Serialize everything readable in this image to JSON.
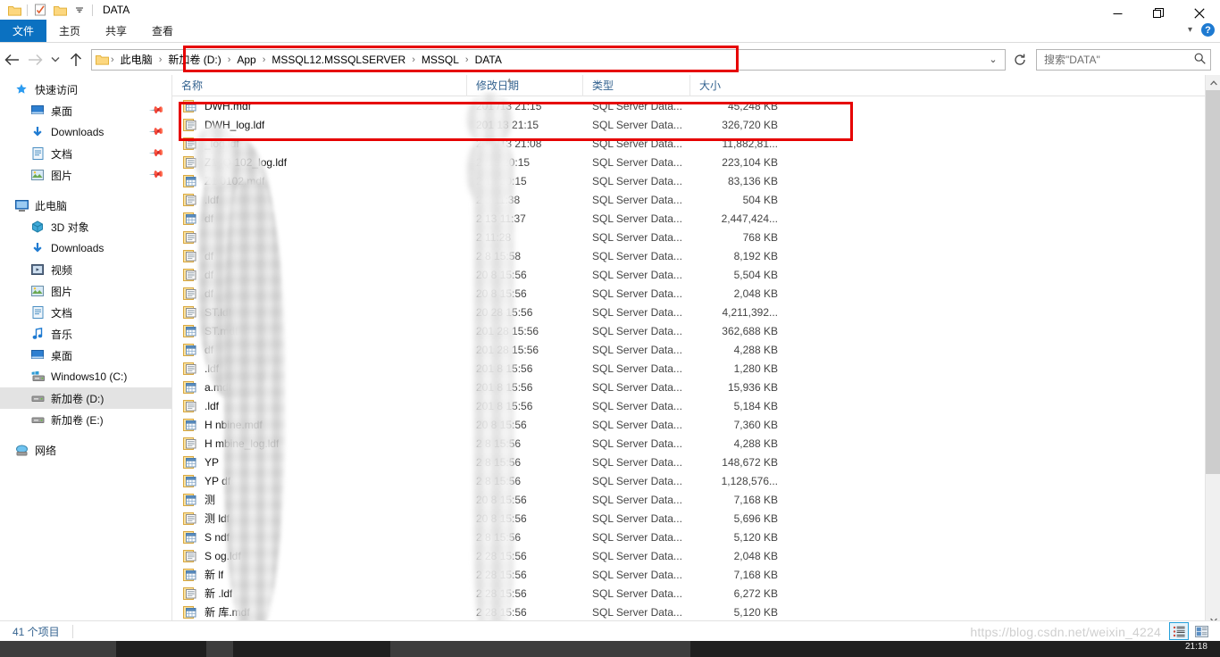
{
  "window": {
    "title": "DATA",
    "quick_access": [
      "folder-icon",
      "properties-checkbox-icon",
      "new-folder-icon",
      "customize-dropdown-icon"
    ],
    "controls": {
      "minimize": "—",
      "maximize": "❐",
      "close": "✕"
    }
  },
  "ribbon": {
    "tabs": [
      {
        "label": "文件",
        "active": true
      },
      {
        "label": "主页",
        "active": false
      },
      {
        "label": "共享",
        "active": false
      },
      {
        "label": "查看",
        "active": false
      }
    ],
    "collapse_icon": "chevron-down-icon",
    "help_label": "?"
  },
  "nav": {
    "back": "←",
    "forward": "→",
    "recent": "⌄",
    "up": "↑",
    "refresh": "↻",
    "history_dropdown": "⌄"
  },
  "address": {
    "folder_icon": "folder-icon",
    "separator": "›",
    "crumbs": [
      "此电脑",
      "新加卷 (D:)",
      "App",
      "MSSQL12.MSSQLSERVER",
      "MSSQL",
      "DATA"
    ]
  },
  "search": {
    "placeholder": "搜索\"DATA\"",
    "value": "",
    "icon": "search-icon"
  },
  "sidebar": {
    "groups": [
      {
        "name": "quick-access",
        "header": {
          "label": "快速访问",
          "icon": "star-pin-icon"
        },
        "items": [
          {
            "label": "桌面",
            "icon": "desktop-icon",
            "pinned": true
          },
          {
            "label": "Downloads",
            "icon": "downloads-icon",
            "pinned": true
          },
          {
            "label": "文档",
            "icon": "documents-icon",
            "pinned": true
          },
          {
            "label": "图片",
            "icon": "pictures-icon",
            "pinned": true
          }
        ]
      },
      {
        "name": "this-pc",
        "header": {
          "label": "此电脑",
          "icon": "computer-icon"
        },
        "items": [
          {
            "label": "3D 对象",
            "icon": "3d-objects-icon",
            "pinned": false
          },
          {
            "label": "Downloads",
            "icon": "downloads-icon",
            "pinned": false
          },
          {
            "label": "视频",
            "icon": "videos-icon",
            "pinned": false
          },
          {
            "label": "图片",
            "icon": "pictures-icon",
            "pinned": false
          },
          {
            "label": "文档",
            "icon": "documents-icon",
            "pinned": false
          },
          {
            "label": "音乐",
            "icon": "music-icon",
            "pinned": false
          },
          {
            "label": "桌面",
            "icon": "desktop-icon",
            "pinned": false
          },
          {
            "label": "Windows10 (C:)",
            "icon": "windows-drive-icon",
            "pinned": false
          },
          {
            "label": "新加卷 (D:)",
            "icon": "drive-icon",
            "pinned": false,
            "selected": true
          },
          {
            "label": "新加卷 (E:)",
            "icon": "drive-icon",
            "pinned": false
          }
        ]
      },
      {
        "name": "network",
        "header": {
          "label": "网络",
          "icon": "network-icon"
        },
        "items": []
      }
    ]
  },
  "filelist": {
    "columns": [
      {
        "key": "name",
        "label": "名称",
        "sorted": false
      },
      {
        "key": "date",
        "label": "修改日期",
        "sorted": true,
        "direction": "desc"
      },
      {
        "key": "type",
        "label": "类型",
        "sorted": false
      },
      {
        "key": "size",
        "label": "大小",
        "sorted": false
      }
    ],
    "rows": [
      {
        "name": "DWH.mdf",
        "icon": "mdf-file-icon",
        "date": "201    /13 21:15",
        "type": "SQL Server Data...",
        "size": "45,248 KB"
      },
      {
        "name": "DWH_log.ldf",
        "icon": "ldf-file-icon",
        "date": "201    13 21:15",
        "type": "SQL Server Data...",
        "size": "326,720 KB"
      },
      {
        "name": "         _log.ldf",
        "icon": "ldf-file-icon",
        "date": "20  5/13 21:08",
        "type": "SQL Server Data...",
        "size": "11,882,81..."
      },
      {
        "name": "    Z1_Q       102_log.ldf",
        "icon": "ldf-file-icon",
        "date": "2     /13 20:15",
        "type": "SQL Server Data...",
        "size": "223,104 KB"
      },
      {
        "name": "    Z1        0102.mdf",
        "icon": "mdf-file-icon",
        "date": "2     13 20:15",
        "type": "SQL Server Data...",
        "size": "83,136 KB"
      },
      {
        "name": "             .ldf",
        "icon": "ldf-file-icon",
        "date": "2    3 11:38",
        "type": "SQL Server Data...",
        "size": "504 KB"
      },
      {
        "name": "            df",
        "icon": "mdf-file-icon",
        "date": "2    13 11:37",
        "type": "SQL Server Data...",
        "size": "2,447,424..."
      },
      {
        "name": "          ",
        "icon": "ldf-file-icon",
        "date": "2      11:28",
        "type": "SQL Server Data...",
        "size": "768 KB"
      },
      {
        "name": "           df",
        "icon": "ldf-file-icon",
        "date": "2    8 15:58",
        "type": "SQL Server Data...",
        "size": "8,192 KB"
      },
      {
        "name": "          df",
        "icon": "ldf-file-icon",
        "date": "20   8 15:56",
        "type": "SQL Server Data...",
        "size": "5,504 KB"
      },
      {
        "name": "         df",
        "icon": "ldf-file-icon",
        "date": "20   8 15:56",
        "type": "SQL Server Data...",
        "size": "2,048 KB"
      },
      {
        "name": "       ST.ldf",
        "icon": "ldf-file-icon",
        "date": "20   28 15:56",
        "type": "SQL Server Data...",
        "size": "4,211,392..."
      },
      {
        "name": "       ST.mdf",
        "icon": "mdf-file-icon",
        "date": "201  28 15:56",
        "type": "SQL Server Data...",
        "size": "362,688 KB"
      },
      {
        "name": "      df",
        "icon": "mdf-file-icon",
        "date": "201  28 15:56",
        "type": "SQL Server Data...",
        "size": "4,288 KB"
      },
      {
        "name": "       .ldf",
        "icon": "ldf-file-icon",
        "date": "201  8 15:56",
        "type": "SQL Server Data...",
        "size": "1,280 KB"
      },
      {
        "name": "      a.mdf",
        "icon": "mdf-file-icon",
        "date": "201  8 15:56",
        "type": "SQL Server Data...",
        "size": "15,936 KB"
      },
      {
        "name": "      .ldf",
        "icon": "ldf-file-icon",
        "date": "201  8 15:56",
        "type": "SQL Server Data...",
        "size": "5,184 KB"
      },
      {
        "name": "H      nbine.mdf",
        "icon": "mdf-file-icon",
        "date": "20   8 15:56",
        "type": "SQL Server Data...",
        "size": "7,360 KB"
      },
      {
        "name": "H      mbine_log.ldf",
        "icon": "ldf-file-icon",
        "date": "2    8 15:56",
        "type": "SQL Server Data...",
        "size": "4,288 KB"
      },
      {
        "name": "YP          ",
        "icon": "mdf-file-icon",
        "date": "2     8 15:56",
        "type": "SQL Server Data...",
        "size": "148,672 KB"
      },
      {
        "name": "YP        df",
        "icon": "mdf-file-icon",
        "date": "2    8 15:56",
        "type": "SQL Server Data...",
        "size": "1,128,576..."
      },
      {
        "name": "测          ",
        "icon": "mdf-file-icon",
        "date": "20   8 15:56",
        "type": "SQL Server Data...",
        "size": "7,168 KB"
      },
      {
        "name": "测        ldf",
        "icon": "ldf-file-icon",
        "date": "20   8 15:56",
        "type": "SQL Server Data...",
        "size": "5,696 KB"
      },
      {
        "name": "S          ndf",
        "icon": "mdf-file-icon",
        "date": "2    8 15:56",
        "type": "SQL Server Data...",
        "size": "5,120 KB"
      },
      {
        "name": "S         og.ldf",
        "icon": "ldf-file-icon",
        "date": "2    28 15:56",
        "type": "SQL Server Data...",
        "size": "2,048 KB"
      },
      {
        "name": "新        lf",
        "icon": "mdf-file-icon",
        "date": "2    28 15:56",
        "type": "SQL Server Data...",
        "size": "7,168 KB"
      },
      {
        "name": "新        .ldf",
        "icon": "ldf-file-icon",
        "date": "2    28 15:56",
        "type": "SQL Server Data...",
        "size": "6,272 KB"
      },
      {
        "name": "新        库.mdf",
        "icon": "mdf-file-icon",
        "date": "2    28 15:56",
        "type": "SQL Server Data...",
        "size": "5,120 KB"
      }
    ]
  },
  "statusbar": {
    "item_count": "41 个项目",
    "views": [
      {
        "name": "details-view",
        "active": true
      },
      {
        "name": "large-icons-view",
        "active": false
      }
    ]
  },
  "watermark": {
    "text": "https://blog.csdn.net/weixin_4224"
  },
  "taskbar": {
    "clock": "21:18"
  },
  "annotations": {
    "address_highlight": "red-rectangle-address-bar",
    "files_highlight": "red-rectangle-dwh-files",
    "color": "#e60000"
  }
}
